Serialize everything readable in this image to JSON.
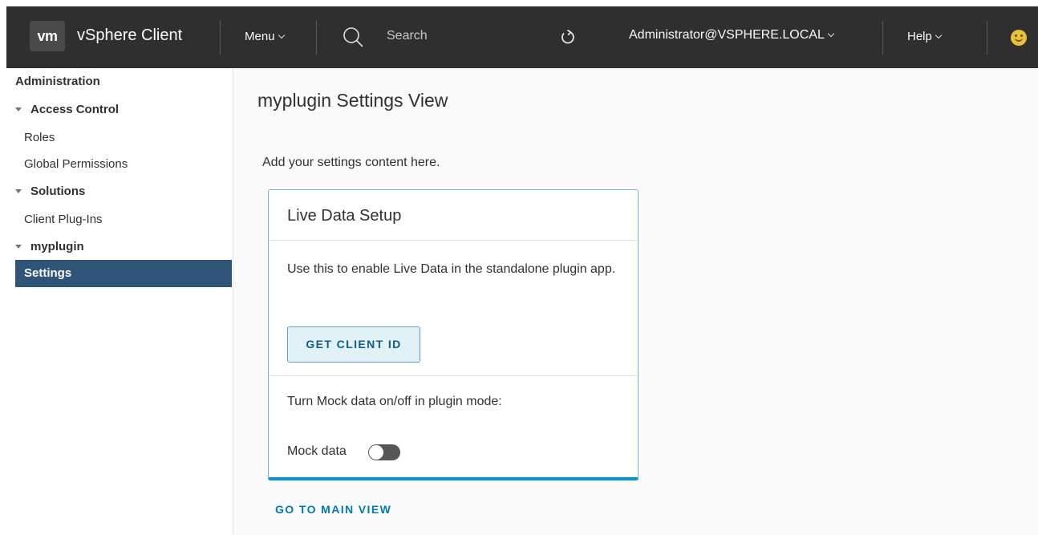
{
  "header": {
    "logo_text": "vm",
    "app_title": "vSphere Client",
    "menu_label": "Menu",
    "search_placeholder": "Search",
    "user_label": "Administrator@VSPHERE.LOCAL",
    "help_label": "Help",
    "bg_color": "#2f2f2f"
  },
  "sidebar": {
    "root": "Administration",
    "groups": [
      {
        "label": "Access Control",
        "items": [
          "Roles",
          "Global Permissions"
        ]
      },
      {
        "label": "Solutions",
        "items": [
          "Client Plug-Ins"
        ]
      },
      {
        "label": "myplugin",
        "items": [
          "Settings"
        ]
      }
    ],
    "active_item": "Settings",
    "active_color": "#2f5478"
  },
  "main": {
    "title": "myplugin Settings View",
    "intro": "Add your settings content here.",
    "card": {
      "title": "Live Data Setup",
      "description": "Use this to enable Live Data in the standalone plugin app.",
      "button_label": "GET CLIENT ID",
      "mock_text": "Turn Mock data on/off in plugin mode:",
      "mock_label": "Mock data",
      "mock_enabled": false
    },
    "link_label": "GO TO MAIN VIEW",
    "accent_color": "#0079b8"
  }
}
